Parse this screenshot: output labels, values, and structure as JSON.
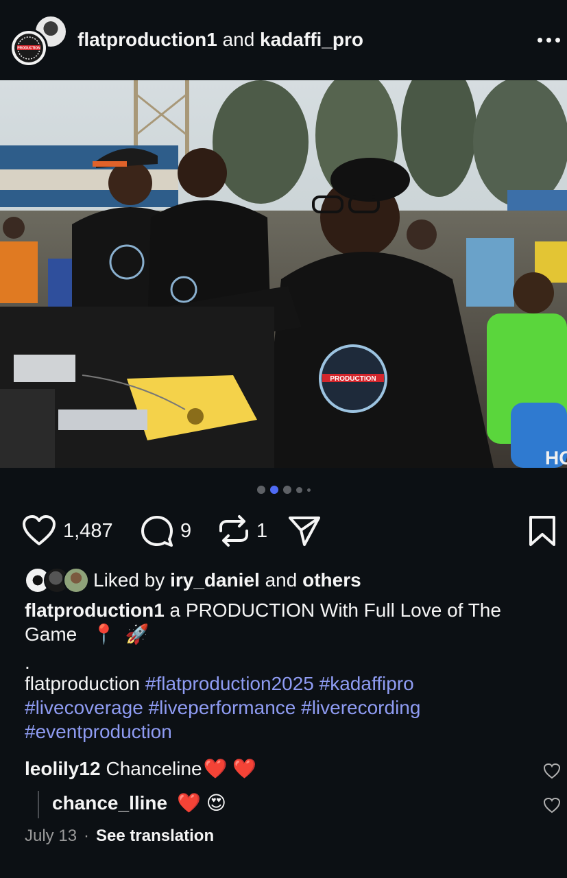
{
  "header": {
    "account1": "flatproduction1",
    "joiner": "and",
    "account2": "kadaffi_pro",
    "avatar_logo_text": "PRODUCTION"
  },
  "photo": {
    "hoodie_logo_text": "PRODUCTION",
    "shirt_text": "HO"
  },
  "carousel": {
    "count": 5,
    "active_index": 1
  },
  "actions": {
    "likes": "1,487",
    "comments": "9",
    "reposts": "1"
  },
  "liked_by": {
    "prefix": "Liked by",
    "user": "iry_daniel",
    "joiner": "and",
    "others": "others"
  },
  "caption": {
    "username": "flatproduction1",
    "text_line1": "a PRODUCTION With Full Love of The",
    "text_line2": "Game",
    "emoji1": "📍",
    "emoji2": "🚀",
    "dot": ".",
    "plain": "flatproduction",
    "hashtags": [
      "#flatproduction2025",
      "#kadaffipro",
      "#livecoverage",
      "#liveperformance",
      "#liverecording",
      "#eventproduction"
    ]
  },
  "comments": [
    {
      "username": "leolily12",
      "text": "Chanceline",
      "emoji": "❤️ ❤️"
    },
    {
      "username": "chance_lline",
      "text": "",
      "emoji": "❤️ 😍"
    }
  ],
  "meta": {
    "date": "July 13",
    "separator": "·",
    "translate": "See translation"
  },
  "colors": {
    "background": "#0c1014",
    "hashtag": "#8f9cf3",
    "active_dot": "#4f6bf5",
    "heart_red": "#e21b2d"
  },
  "icons": [
    "heart-icon",
    "comment-icon",
    "repost-icon",
    "share-icon",
    "bookmark-icon",
    "more-icon"
  ]
}
